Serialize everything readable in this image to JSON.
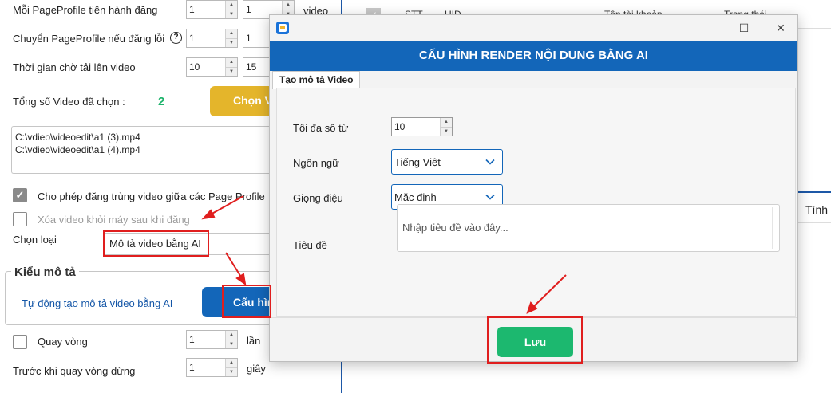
{
  "background": {
    "settings": [
      {
        "label": "Mỗi PageProfile tiến hành đăng",
        "value1": "1",
        "value2": "1",
        "suffix": "video"
      },
      {
        "label": "Chuyển PageProfile nếu đăng lỗi",
        "value1": "1",
        "value2": "1"
      },
      {
        "label": "Thời gian chờ tải lên video",
        "value1": "10",
        "value2": "15"
      }
    ],
    "selected_count_label": "Tổng số Video đã chọn :",
    "selected_count": "2",
    "choose_button": "Chọn V",
    "files": [
      "C:\\vdieo\\videoedit\\a1 (3).mp4",
      "C:\\vdieo\\videoedit\\a1 (4).mp4"
    ],
    "allow_duplicate_label": "Cho phép đăng trùng video giữa các Page Profile",
    "delete_video_label": "Xóa video khỏi máy sau khi đăng",
    "choose_type_label": "Chọn loại",
    "choose_type_value": "Mô tả video bằng AI",
    "description_group_title": "Kiểu mô tả",
    "auto_description_label": "Tự động tạo mô tả video bằng AI",
    "config_button": "Cấu hìn",
    "loop_label": "Quay vòng",
    "loop_value": "1",
    "loop_unit": "lần",
    "before_loop_stop_label": "Trước khi quay vòng dừng",
    "before_loop_stop_value": "1",
    "before_loop_stop_unit": "giây",
    "table_headers": [
      "STT",
      "UID",
      "Tên tài khoản",
      "Trạng thái"
    ],
    "right_tab": "Tình t"
  },
  "dialog": {
    "title": "CẤU HÌNH RENDER NỘI DUNG BẰNG AI",
    "tab": "Tạo mô tả Video",
    "max_words_label": "Tối đa số từ",
    "max_words_value": "10",
    "language_label": "Ngôn ngữ",
    "language_value": "Tiếng Việt",
    "tone_label": "Giọng điệu",
    "tone_value": "Mặc định",
    "title_label": "Tiêu đề",
    "title_placeholder": "Nhập tiêu đề vào đây...",
    "save_button": "Lưu"
  },
  "colors": {
    "primary": "#1366b9",
    "save_green": "#1cb86f",
    "choose_yellow": "#e4b52b",
    "count_green": "#1db36b",
    "annotation_red": "#e01e1e"
  }
}
